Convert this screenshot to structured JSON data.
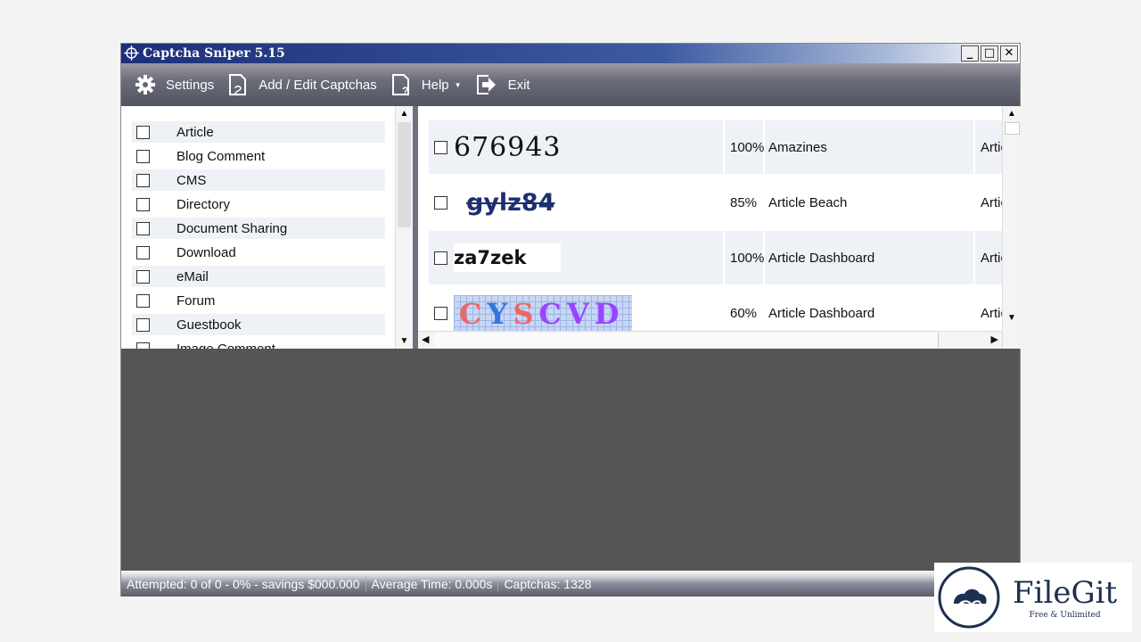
{
  "window": {
    "title": "Captcha Sniper 5.15",
    "controls": [
      "_",
      "□",
      "✕"
    ]
  },
  "toolbar": {
    "settings": "Settings",
    "add_edit": "Add / Edit Captchas",
    "help": "Help",
    "exit": "Exit"
  },
  "categories": [
    "Article",
    "Blog Comment",
    "CMS",
    "Directory",
    "Document Sharing",
    "Download",
    "eMail",
    "Forum",
    "Guestbook",
    "Image Comment"
  ],
  "captchas": [
    {
      "text": "676943",
      "accuracy": "100%",
      "name": "Amazines",
      "type": "Artic"
    },
    {
      "text": "gylz84",
      "accuracy": "85%",
      "name": "Article Beach",
      "type": "Artic"
    },
    {
      "text": "za7zek",
      "accuracy": "100%",
      "name": "Article Dashboard",
      "type": "Artic"
    },
    {
      "text": "CYSCVD",
      "accuracy": "60%",
      "name": "Article Dashboard",
      "type": "Artic"
    }
  ],
  "status": {
    "attempted": "Attempted: 0 of 0 - 0% - savings $000.000",
    "avg_time": "Average Time: 0.000s",
    "captchas": "Captchas: 1328"
  },
  "watermark": {
    "name": "FileGit",
    "tagline": "Free & Unlimited"
  }
}
